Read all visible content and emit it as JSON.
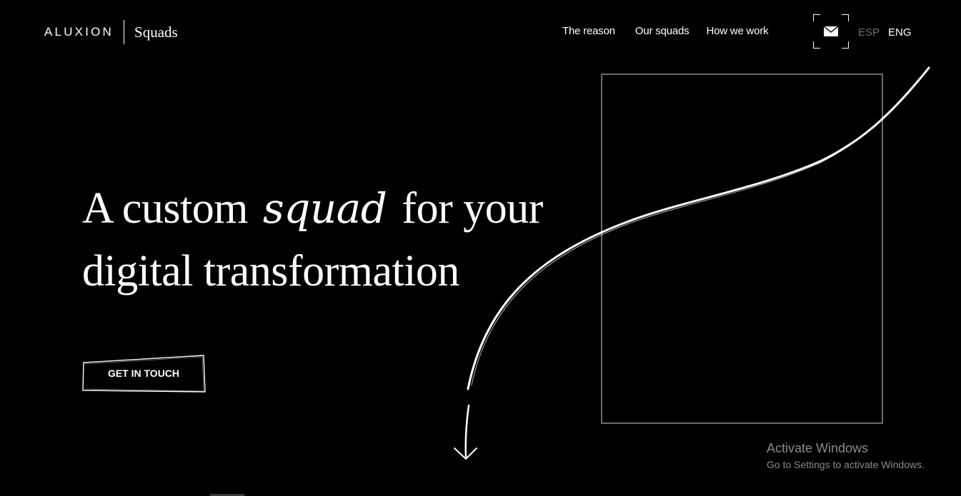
{
  "header": {
    "brand_name": "ALUXION",
    "brand_sub": "Squads",
    "nav": [
      {
        "label": "The reason"
      },
      {
        "label": "Our squads"
      },
      {
        "label": "How we work"
      }
    ],
    "mail_icon": "envelope-icon",
    "lang_esp": "ESP",
    "lang_eng": "ENG"
  },
  "hero": {
    "title_part1": "A custom",
    "title_accent": "squad",
    "title_part2": "for your",
    "title_line2": "digital transformation",
    "cta_label": "GET IN TOUCH"
  },
  "decor": {
    "scroll_arrow_icon": "down-arrow-icon"
  },
  "watermark": {
    "line1": "Activate Windows",
    "line2": "Go to Settings to activate Windows."
  }
}
